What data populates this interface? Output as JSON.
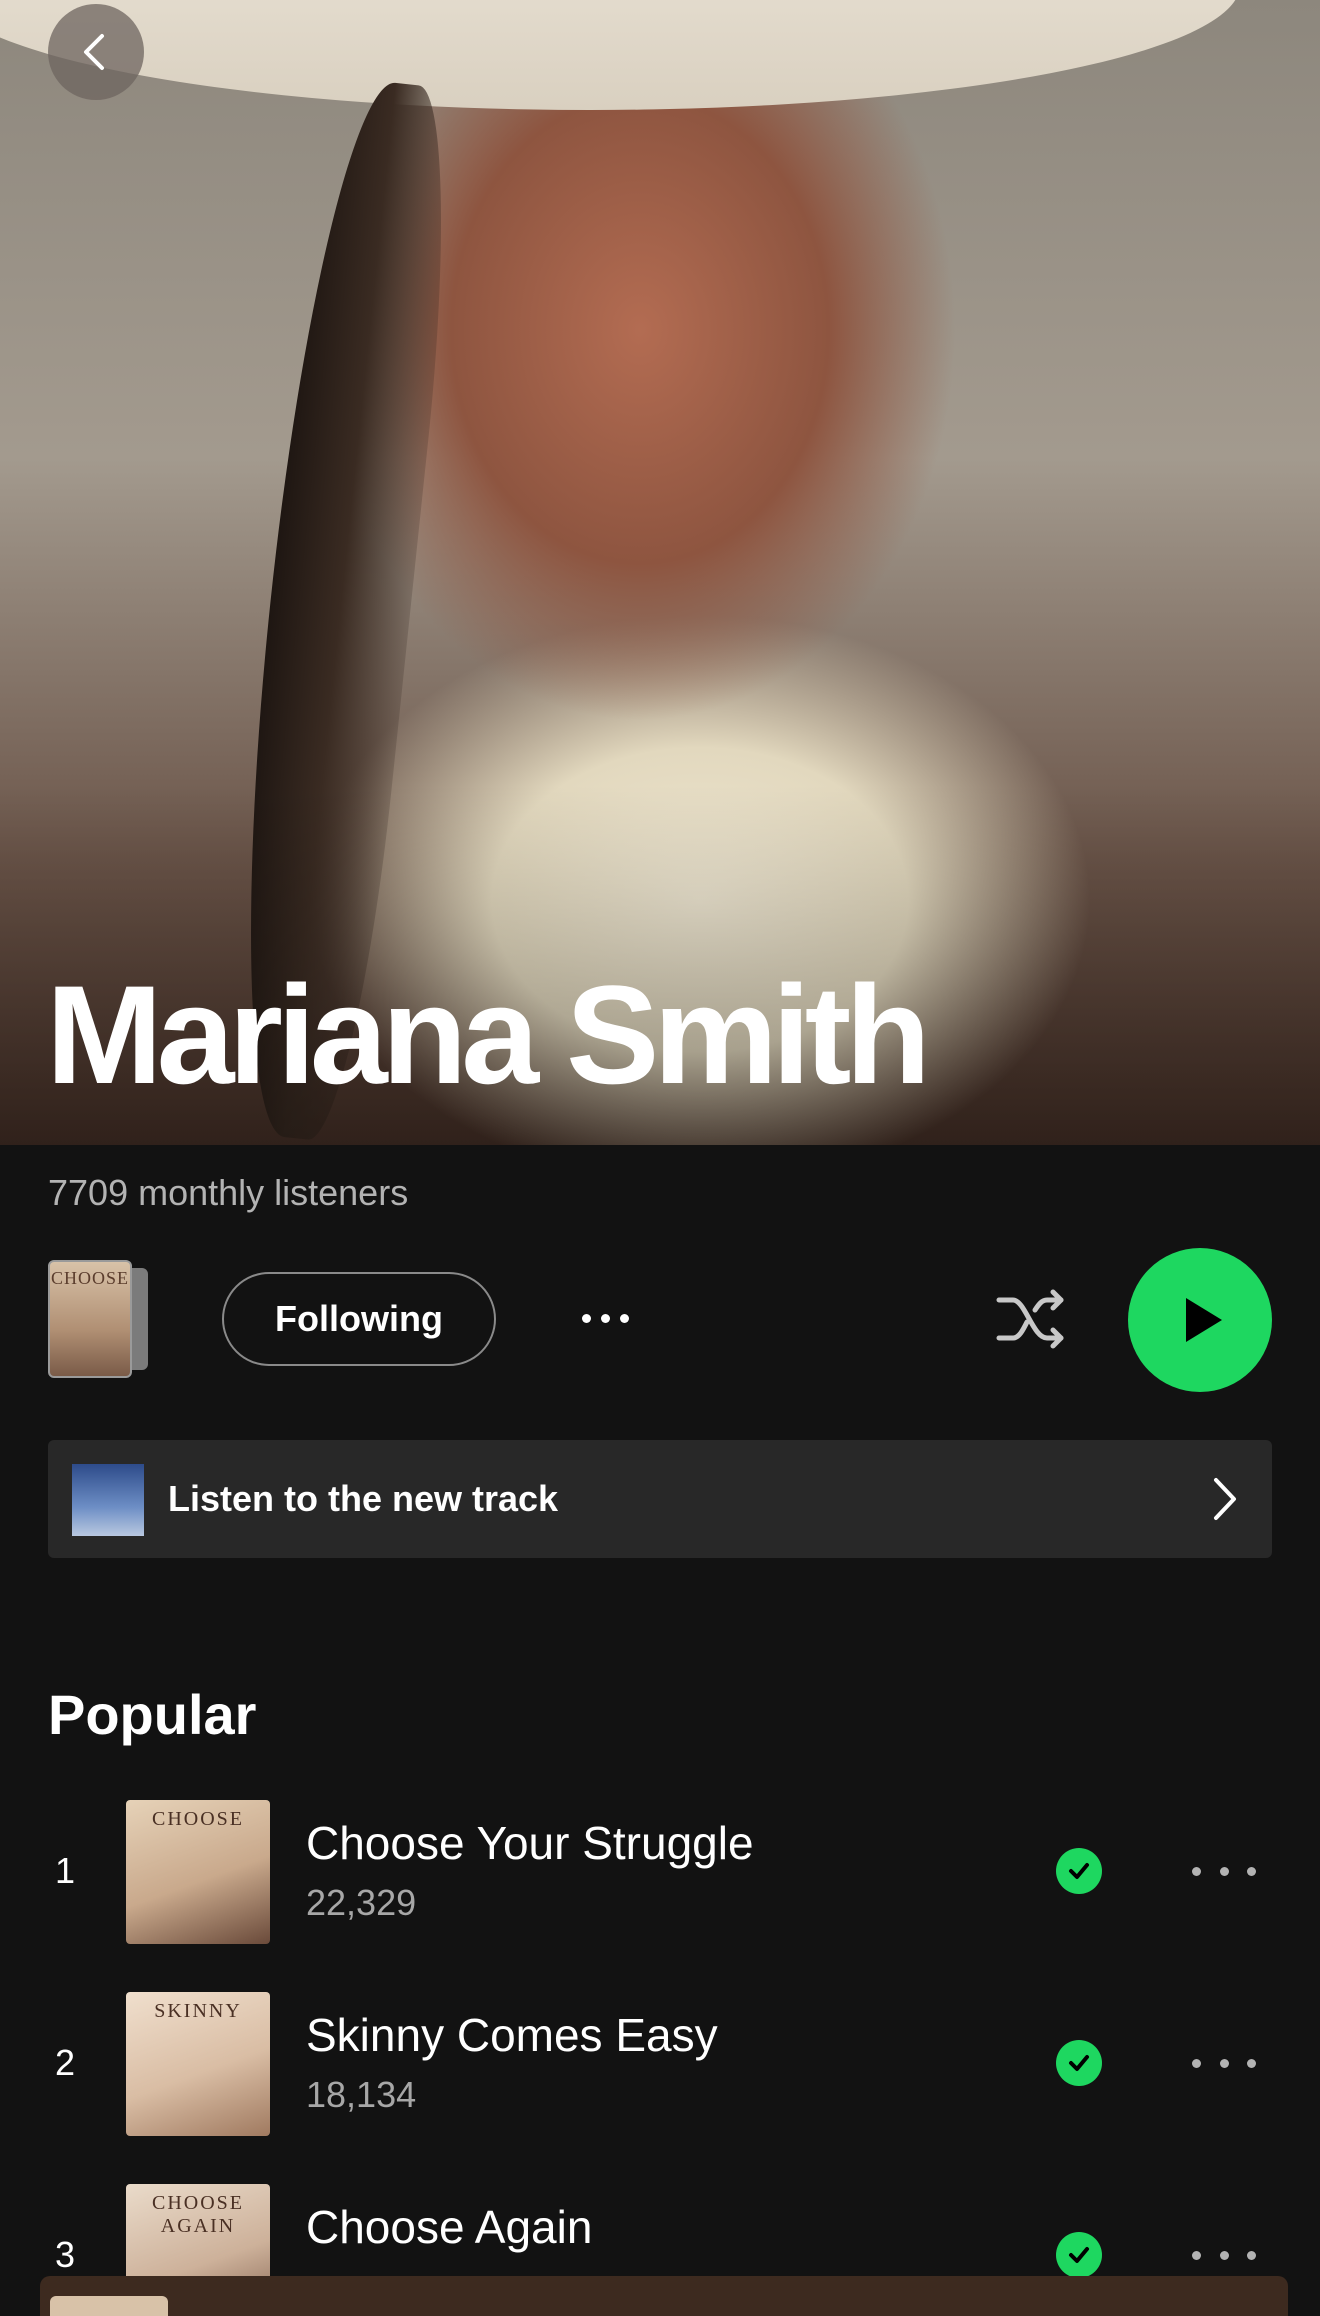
{
  "artist": {
    "name": "Mariana Smith",
    "monthly_listeners": "7709 monthly listeners"
  },
  "actions": {
    "follow_label": "Following",
    "cover_text": "CHOOSE"
  },
  "new_track": {
    "label": "Listen to the new track"
  },
  "popular": {
    "title": "Popular",
    "tracks": [
      {
        "rank": "1",
        "title": "Choose Your Struggle",
        "plays": "22,329",
        "art_text": "CHOOSE"
      },
      {
        "rank": "2",
        "title": "Skinny Comes Easy",
        "plays": "18,134",
        "art_text": "SKINNY"
      },
      {
        "rank": "3",
        "title": "Choose Again",
        "plays": "",
        "art_text": "CHOOSE AGAIN"
      }
    ]
  },
  "colors": {
    "accent": "#1ed760",
    "background": "#121212",
    "card": "#282828"
  },
  "icons": {
    "back": "chevron-left-icon",
    "shuffle": "shuffle-icon",
    "play": "play-icon",
    "more": "more-horizontal-icon",
    "downloaded": "check-circle-icon",
    "chevron": "chevron-right-icon"
  }
}
